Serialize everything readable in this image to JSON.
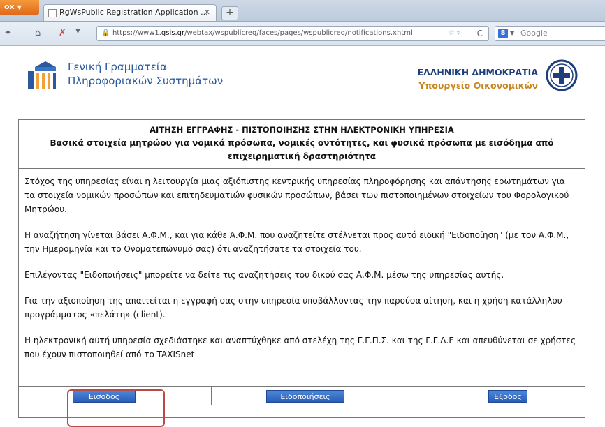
{
  "browser": {
    "app_button": "ox",
    "tab_title": "RgWsPublic Registration Application ...",
    "url_prefix": "https://www1.",
    "url_domain": "gsis.gr",
    "url_suffix": "/webtax/wspublicreg/faces/pages/wspublicreg/notifications.xhtml",
    "search_placeholder": "Google"
  },
  "header": {
    "org_line1": "Γενική Γραμματεία",
    "org_line2": "Πληροφοριακών Συστημάτων",
    "gov_line1": "ΕΛΛΗΝΙΚΗ ΔΗΜΟΚΡΑΤΙΑ",
    "gov_line2": "Υπουργείο Οικονομικών"
  },
  "panel": {
    "title": "ΑΙΤΗΣΗ ΕΓΓΡΑΦΗΣ - ΠΙΣΤΟΠΟΙΗΣΗΣ ΣΤΗΝ ΗΛΕΚΤΡΟΝΙΚΗ ΥΠΗΡΕΣΙΑ",
    "subtitle": "Βασικά στοιχεία μητρώου για νομικά πρόσωπα, νομικές οντότητες, και φυσικά πρόσωπα με εισόδημα από επιχειρηματική δραστηριότητα",
    "paragraphs": [
      "Στόχος της υπηρεσίας είναι η λειτουργία μιας αξιόπιστης κεντρικής υπηρεσίας πληροφόρησης και απάντησης ερωτημάτων για τα στοιχεία νομικών προσώπων και επιτηδευματιών φυσικών προσώπων, βάσει των πιστοποιημένων στοιχείων του Φορολογικού Μητρώου.",
      "Η αναζήτηση γίνεται βάσει Α.Φ.Μ., και για κάθε Α.Φ.Μ. που αναζητείτε στέλνεται προς αυτό ειδική \"Ειδοποίηση\" (με τον Α.Φ.Μ., την Ημερομηνία και το Ονοματεπώνυμό σας) ότι αναζητήσατε τα στοιχεία του.",
      "Επιλέγοντας \"Ειδοποιήσεις\" μπορείτε να δείτε τις αναζητήσεις του δικού σας Α.Φ.Μ. μέσω της υπηρεσίας αυτής.",
      "Για την αξιοποίηση της απαιτείται η εγγραφή σας στην υπηρεσία υποβάλλοντας την παρούσα αίτηση, και η χρήση κατάλληλου προγράμματος «πελάτη» (client).",
      "Η ηλεκτρονική αυτή υπηρεσία σχεδιάστηκε και αναπτύχθηκε από στελέχη της Γ.Γ.Π.Σ. και της Γ.Γ.Δ.Ε και απευθύνεται σε χρήστες που έχουν πιστοποιηθεί από το TAXISnet"
    ]
  },
  "buttons": {
    "login": "Εισοδος",
    "notifications": "Ειδοποιήσεις",
    "exit": "Εξοδος"
  },
  "colors": {
    "button_blue": "#2a5fb8",
    "highlight_red": "#b84a4a",
    "gsis_blue": "#2b5a9c"
  }
}
